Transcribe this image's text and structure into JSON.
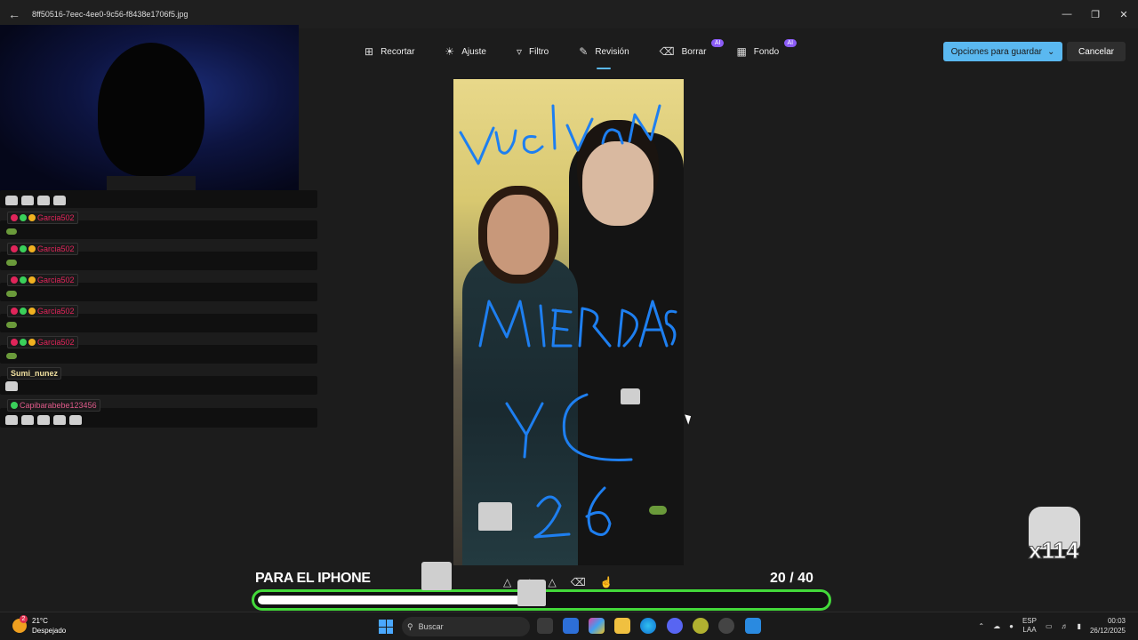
{
  "window": {
    "title": "8ff50516-7eec-4ee0-9c56-f8438e1706f5.jpg"
  },
  "toolbar": {
    "tools": [
      {
        "label": "Recortar",
        "icon": "crop-icon"
      },
      {
        "label": "Ajuste",
        "icon": "brightness-icon"
      },
      {
        "label": "Filtro",
        "icon": "filter-icon"
      },
      {
        "label": "Revisión",
        "icon": "markup-icon",
        "active": true
      },
      {
        "label": "Borrar",
        "icon": "erase-icon",
        "badge": "AI"
      },
      {
        "label": "Fondo",
        "icon": "background-icon",
        "badge": "AI"
      }
    ],
    "save_label": "Opciones para guardar",
    "cancel_label": "Cancelar"
  },
  "chat": {
    "messages": [
      {
        "user": "Garcia502",
        "color": "#e0255a"
      },
      {
        "user": "Garcia502",
        "color": "#e0255a"
      },
      {
        "user": "Garcia502",
        "color": "#e0255a"
      },
      {
        "user": "Garcia502",
        "color": "#e0255a"
      },
      {
        "user": "Garcia502",
        "color": "#e0255a"
      },
      {
        "user": "Sumi_nunez",
        "color": "#f0e0a0"
      },
      {
        "user": "Capibarabebe123456",
        "color": "#e05a8a"
      }
    ]
  },
  "overlay": {
    "goal_label": "PARA EL IPHONE",
    "goal_current": "20",
    "goal_total": "/ 40",
    "progress_fraction": 0.5,
    "combo_count": "x114"
  },
  "taskbar": {
    "temperature": "21°C",
    "weather": "Despejado",
    "weather_badge": "2",
    "search_placeholder": "Buscar",
    "lang_top": "ESP",
    "lang_bottom": "LAA",
    "time": "00:03",
    "date": "26/12/2025"
  },
  "colors": {
    "accent": "#5ab8f0",
    "progress_border": "#43d93a",
    "ai_badge": "#8b5cf6"
  }
}
